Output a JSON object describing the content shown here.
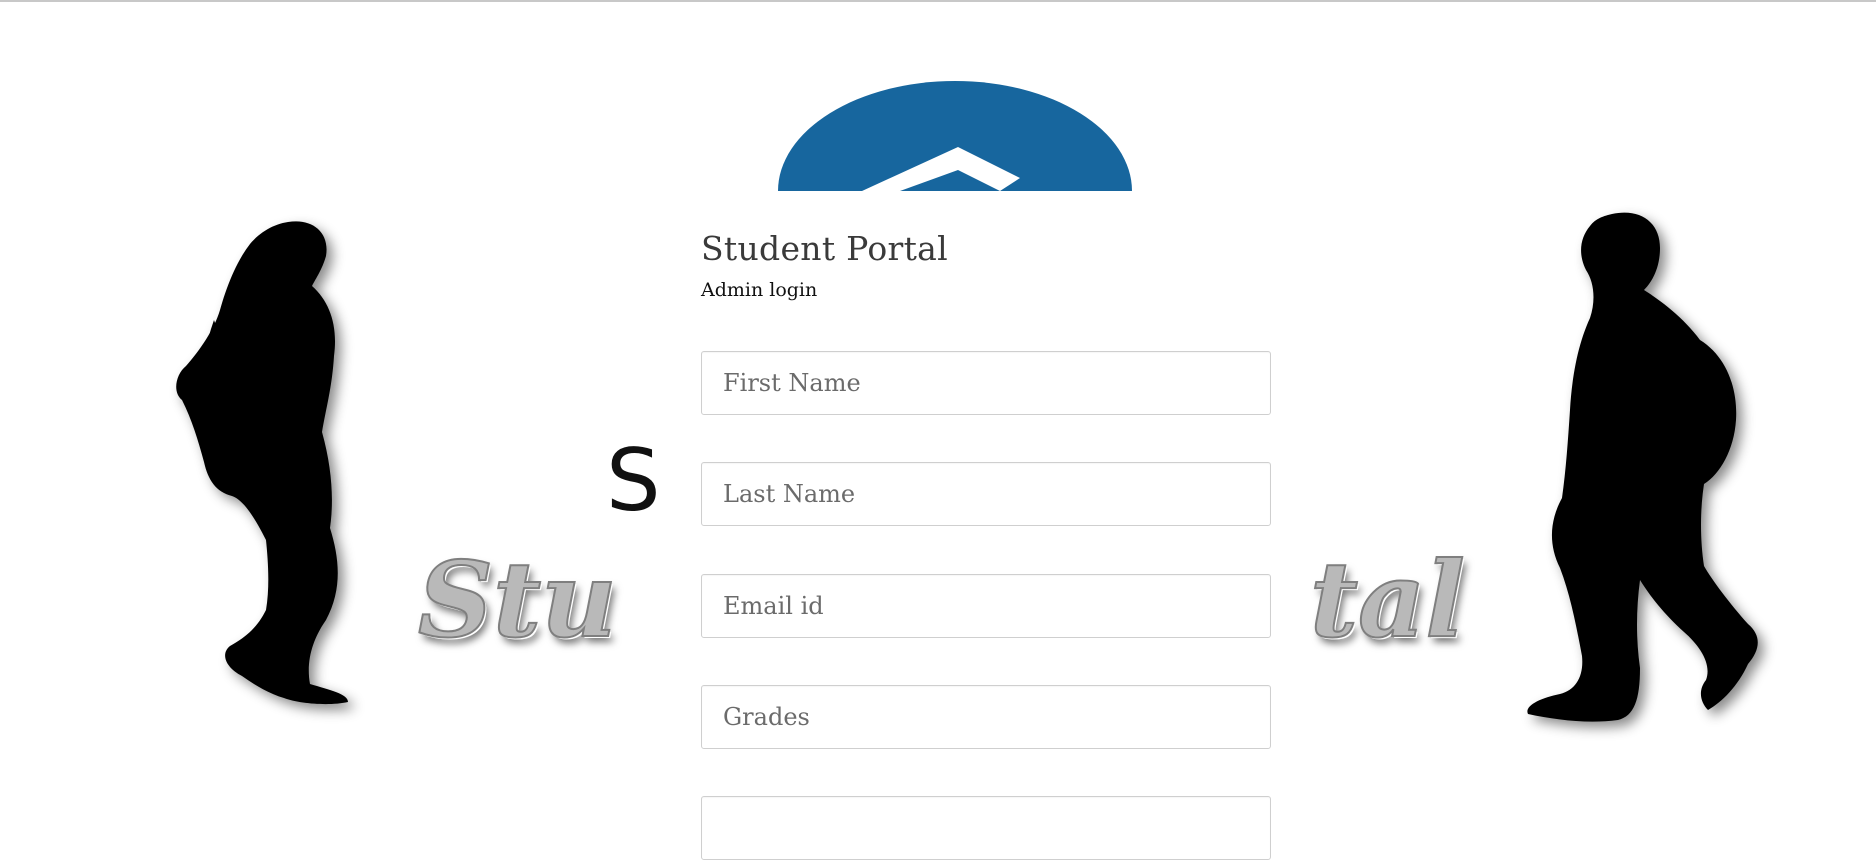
{
  "form": {
    "title": "Student Portal",
    "subtitle": "Admin login",
    "fields": [
      {
        "placeholder": "First Name",
        "value": ""
      },
      {
        "placeholder": "Last Name",
        "value": ""
      },
      {
        "placeholder": "Email id",
        "value": ""
      },
      {
        "placeholder": "Grades",
        "value": ""
      },
      {
        "placeholder": "",
        "value": ""
      }
    ]
  },
  "banner": {
    "logo_letter": "S",
    "watermark_left": "Stu",
    "watermark_right": "tal",
    "logo_color": "#17669e"
  }
}
